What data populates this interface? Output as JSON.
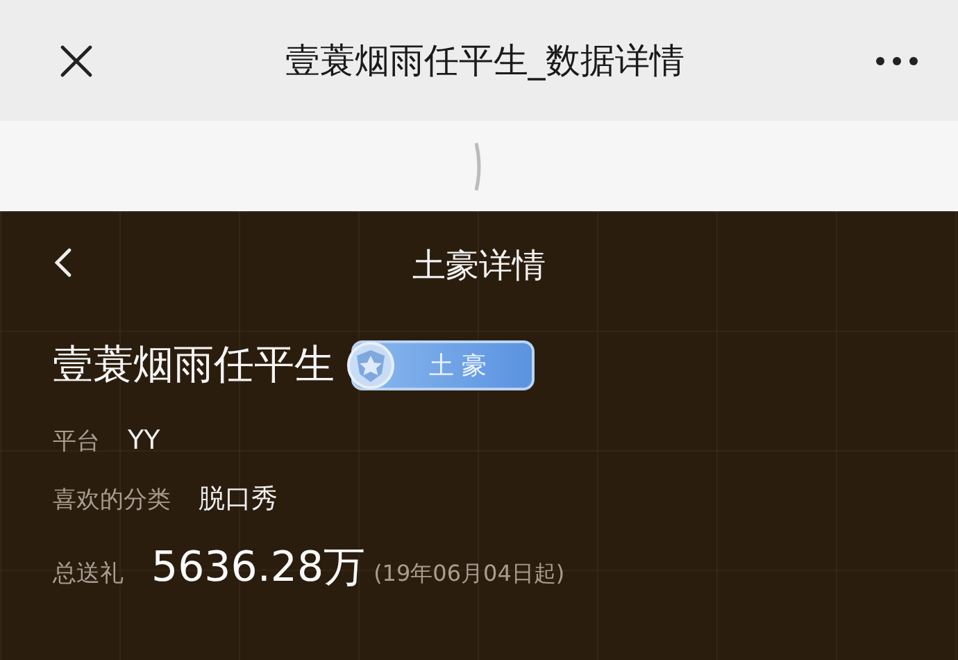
{
  "window": {
    "title": "壹蓑烟雨任平生_数据详情"
  },
  "panel": {
    "title": "土豪详情",
    "user_name": "壹蓑烟雨任平生",
    "badge": {
      "label": "土 豪"
    },
    "fields": [
      {
        "label": "平台",
        "value": "YY"
      },
      {
        "label": "喜欢的分类",
        "value": "脱口秀"
      }
    ],
    "total_gifts": {
      "label": "总送礼",
      "value": "5636.28万",
      "note": "(19年06月04日起)"
    }
  }
}
